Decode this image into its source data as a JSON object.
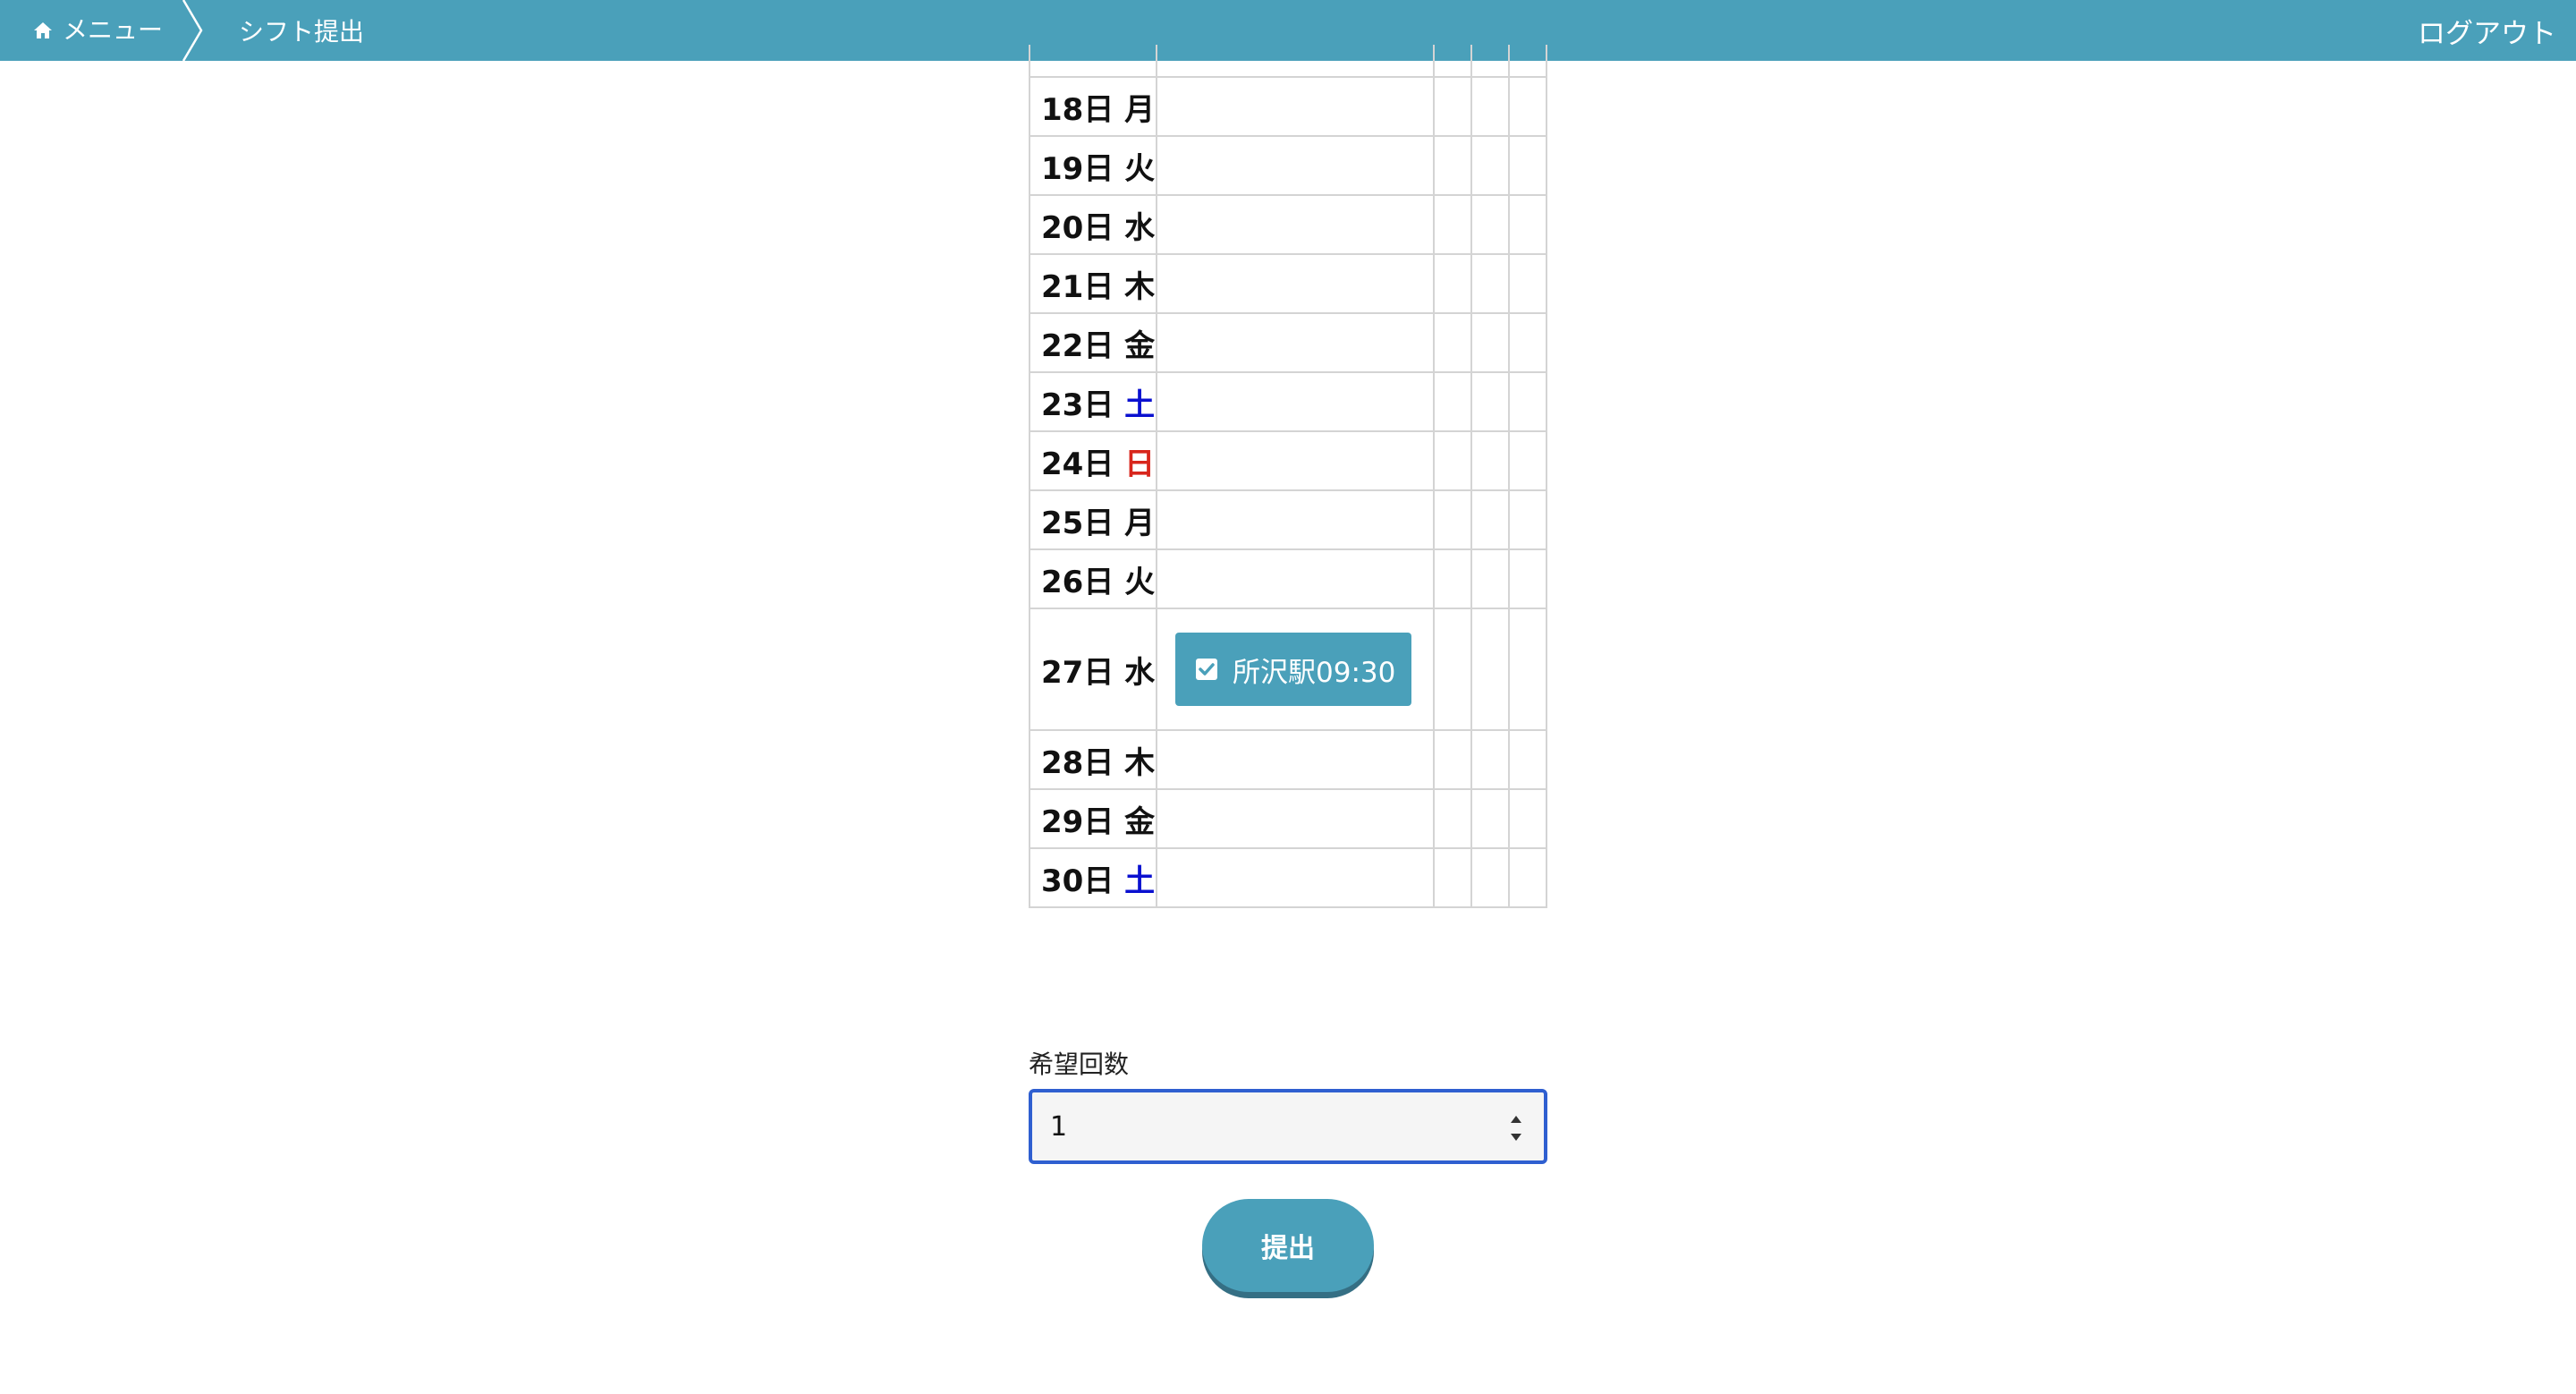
{
  "header": {
    "home_label": "メニュー",
    "current_page": "シフト提出",
    "logout_label": "ログアウト",
    "bar_color": "#4aa0ba"
  },
  "schedule": {
    "rows": [
      {
        "day": "18日",
        "weekday": "月",
        "type": "weekday",
        "shift": ""
      },
      {
        "day": "19日",
        "weekday": "火",
        "type": "weekday",
        "shift": ""
      },
      {
        "day": "20日",
        "weekday": "水",
        "type": "weekday",
        "shift": ""
      },
      {
        "day": "21日",
        "weekday": "木",
        "type": "weekday",
        "shift": ""
      },
      {
        "day": "22日",
        "weekday": "金",
        "type": "weekday",
        "shift": ""
      },
      {
        "day": "23日",
        "weekday": "土",
        "type": "saturday",
        "shift": ""
      },
      {
        "day": "24日",
        "weekday": "日",
        "type": "sunday",
        "shift": ""
      },
      {
        "day": "25日",
        "weekday": "月",
        "type": "weekday",
        "shift": ""
      },
      {
        "day": "26日",
        "weekday": "火",
        "type": "weekday",
        "shift": ""
      },
      {
        "day": "27日",
        "weekday": "水",
        "type": "weekday",
        "shift": "所沢駅09:30",
        "checked": true
      },
      {
        "day": "28日",
        "weekday": "木",
        "type": "weekday",
        "shift": ""
      },
      {
        "day": "29日",
        "weekday": "金",
        "type": "weekday",
        "shift": ""
      },
      {
        "day": "30日",
        "weekday": "土",
        "type": "saturday",
        "shift": ""
      }
    ]
  },
  "form": {
    "count_label": "希望回数",
    "count_value": "1",
    "submit_label": "提出"
  },
  "colors": {
    "saturday": "#0a10d0",
    "sunday": "#d8261c",
    "accent": "#4aa0ba",
    "focus_border": "#2f5fd0"
  },
  "icons": {
    "home": "home-icon",
    "breadcrumb_separator": "chevron-right-icon",
    "checkbox": "checkbox-checked-icon",
    "spinner": "number-spinner-icon"
  }
}
